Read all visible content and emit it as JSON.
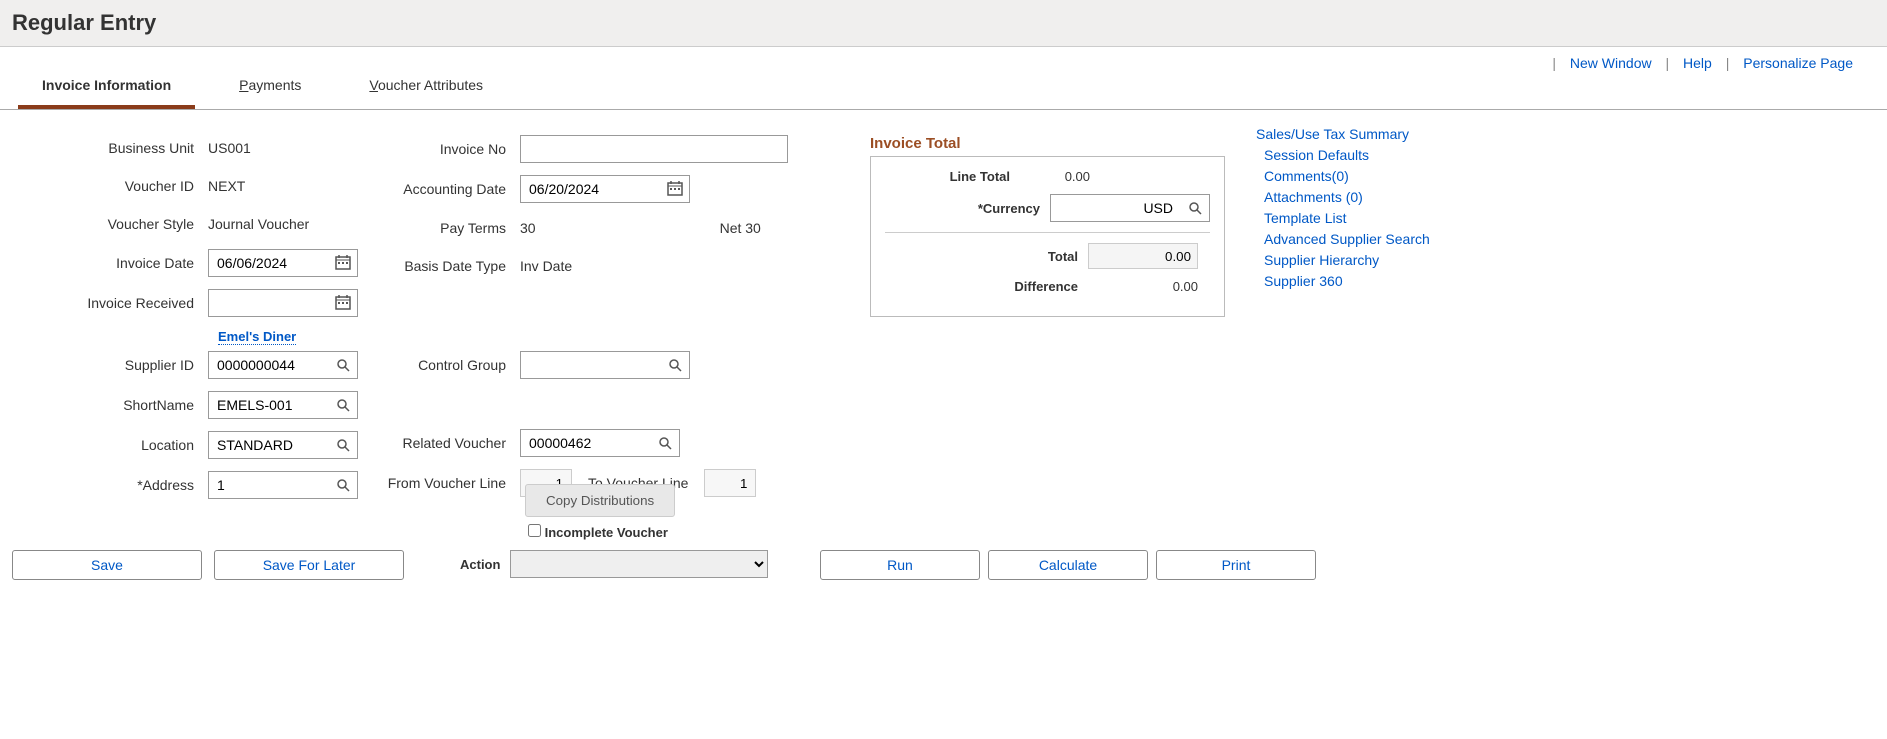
{
  "page_title": "Regular Entry",
  "top_links": {
    "new_window": "New Window",
    "help": "Help",
    "personalize": "Personalize Page"
  },
  "tabs": {
    "invoice_info": "Invoice Information",
    "payments_full": "Payments",
    "payments_prefix": "P",
    "payments_rest": "ayments",
    "voucher_attr_full": "Voucher Attributes",
    "voucher_attr_prefix": "V",
    "voucher_attr_rest": "oucher Attributes"
  },
  "left": {
    "business_unit_label": "Business Unit",
    "business_unit": "US001",
    "voucher_id_label": "Voucher ID",
    "voucher_id": "NEXT",
    "voucher_style_label": "Voucher Style",
    "voucher_style": "Journal Voucher",
    "invoice_date_label": "Invoice Date",
    "invoice_date": "06/06/2024",
    "invoice_received_label": "Invoice Received",
    "invoice_received": "",
    "supplier_name": "Emel's Diner",
    "supplier_id_label": "Supplier ID",
    "supplier_id": "0000000044",
    "short_name_label": "ShortName",
    "short_name": "EMELS-001",
    "location_label": "Location",
    "location": "STANDARD",
    "address_label": "*Address",
    "address": "1"
  },
  "mid": {
    "invoice_no_label": "Invoice No",
    "invoice_no": "",
    "accounting_date_label": "Accounting Date",
    "accounting_date": "06/20/2024",
    "pay_terms_label": "Pay Terms",
    "pay_terms": "30",
    "pay_terms_desc": "Net 30",
    "basis_date_type_label": "Basis Date Type",
    "basis_date_type": "Inv Date",
    "control_group_label": "Control Group",
    "control_group": "",
    "related_voucher_label": "Related Voucher",
    "related_voucher": "00000462",
    "from_line_label": "From Voucher Line",
    "from_line": "1",
    "to_line_label": "To Voucher Line",
    "to_line": "1",
    "copy_dist": "Copy Distributions",
    "incomplete_label": "Incomplete Voucher"
  },
  "invoice_total": {
    "title": "Invoice Total",
    "line_total_label": "Line Total",
    "line_total": "0.00",
    "currency_label": "*Currency",
    "currency": "USD",
    "total_label": "Total",
    "total": "0.00",
    "difference_label": "Difference",
    "difference": "0.00"
  },
  "right_links": {
    "sales_tax": "Sales/Use Tax Summary",
    "session_defaults": "Session Defaults",
    "comments": "Comments(0)",
    "attachments": "Attachments (0)",
    "template_list": "Template List",
    "adv_supplier": "Advanced Supplier Search",
    "supplier_hierarchy": "Supplier Hierarchy",
    "supplier_360": "Supplier 360"
  },
  "bottom": {
    "save": "Save",
    "save_later": "Save For Later",
    "action_label": "Action",
    "run": "Run",
    "calculate": "Calculate",
    "print": "Print"
  }
}
